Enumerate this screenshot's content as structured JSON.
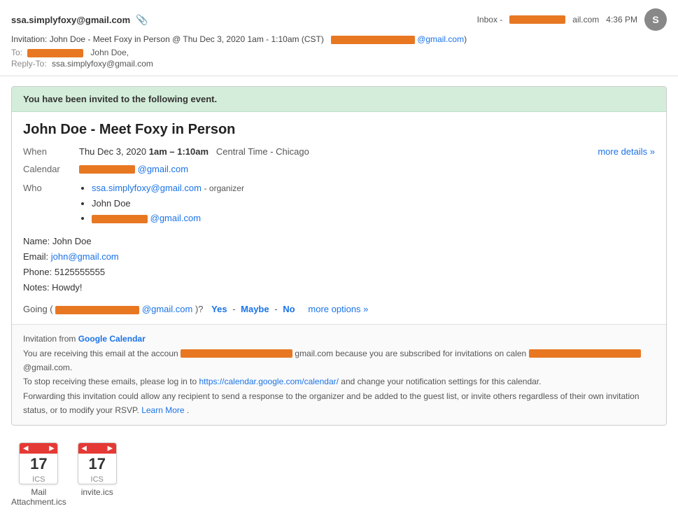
{
  "header": {
    "sender_email": "ssa.simplyfoxy@gmail.com",
    "attachment_icon": "📎",
    "inbox_label": "Inbox -",
    "redacted_email_short": "",
    "time": "4:36 PM",
    "avatar_letter": "S",
    "subject": "Invitation: John Doe - Meet Foxy in Person @ Thu Dec 3, 2020 1am - 1:10am (CST)",
    "to_label": "To:",
    "to_name": "John Doe,",
    "reply_to_label": "Reply-To:",
    "reply_to": "ssa.simplyfoxy@gmail.com"
  },
  "event": {
    "banner": "You have been invited to the following event.",
    "title": "John Doe - Meet Foxy in Person",
    "when_label": "When",
    "when_date": "Thu Dec 3, 2020",
    "when_time": "1am – 1:10am",
    "when_timezone": "Central Time - Chicago",
    "more_details": "more details »",
    "calendar_label": "Calendar",
    "who_label": "Who",
    "who_list": [
      {
        "name": "ssa.simplyfoxy@gmail.com",
        "role": "- organizer",
        "is_link": true
      },
      {
        "name": "John Doe",
        "role": "",
        "is_link": false
      },
      {
        "name": "",
        "role": "",
        "is_link": true,
        "redacted": true
      }
    ],
    "notes_name": "Name: John Doe",
    "notes_email_label": "Email:",
    "notes_email": "john@gmail.com",
    "notes_phone": "Phone: 5125555555",
    "notes_notes": "Notes: Howdy!",
    "going_label": "Going (",
    "going_suffix": ")?",
    "rsvp_yes": "Yes",
    "rsvp_maybe": "Maybe",
    "rsvp_no": "No",
    "rsvp_options": "more options »",
    "footer_invitation": "Invitation from",
    "footer_google_cal": "Google Calendar",
    "footer_text1": "You are receiving this email at the accoun",
    "footer_text1b": "gmail.com because you are subscribed for invitations on calen",
    "footer_text1c": "@gmail.com.",
    "footer_text2": "To stop receiving these emails, please log in to",
    "footer_cal_url": "https://calendar.google.com/calendar/",
    "footer_text2b": "and change your notification settings for this calendar.",
    "footer_text3": "Forwarding this invitation could allow any recipient to send a response to the organizer and be added to the guest list, or invite others regardless of their own invitation status, or to modify your RSVP.",
    "learn_more": "Learn More",
    "attachments": [
      {
        "label": "ICS",
        "date": "17",
        "name": "Mail\nAttachment.ics"
      },
      {
        "label": "ICS",
        "date": "17",
        "name": "invite.ics"
      }
    ]
  }
}
